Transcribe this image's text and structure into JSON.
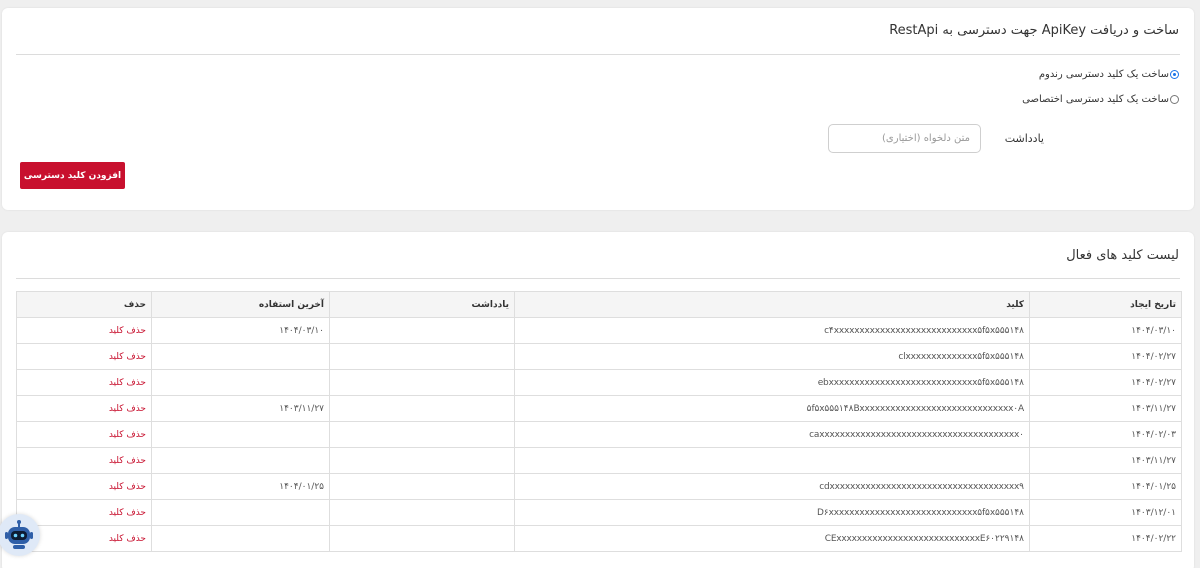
{
  "create_section": {
    "title": "ساخت و دریافت ApiKey جهت دسترسی به RestApi",
    "radio_random": {
      "label": "ساخت یک کلید دسترسی رندوم",
      "checked": true
    },
    "radio_custom": {
      "label": "ساخت یک کلید دسترسی اختصاصی",
      "checked": false
    },
    "note_label": "یادداشت",
    "note_placeholder": "متن دلخواه (اختیاری)",
    "note_value": "",
    "add_button": "افزودن کلید دسترسی",
    "accent_color": "#c8102e"
  },
  "active_keys": {
    "title": "لیست کلید های فعال",
    "columns": [
      "تاریخ ایجاد",
      "کلید",
      "یادداشت",
      "آخرین استفاده",
      "حذف"
    ],
    "rows": [
      {
        "created": "۱۴۰۴/۰۳/۱۰",
        "key": "c۴xxxxxxxxxxxxxxxxxxxxxxxxxxxx۵f۵x۵۵۵۱۴۸",
        "note": "",
        "last_used": "۱۴۰۴/۰۳/۱۰",
        "delete": "حذف کلید"
      },
      {
        "created": "۱۴۰۴/۰۲/۲۷",
        "key": "clxxxxxxxxxxxxxx۵f۵x۵۵۵۱۴۸",
        "note": "",
        "last_used": "",
        "delete": "حذف کلید"
      },
      {
        "created": "۱۴۰۴/۰۲/۲۷",
        "key": "ebxxxxxxxxxxxxxxxxxxxxxxxxxxxxx۵f۵x۵۵۵۱۴۸",
        "note": "",
        "last_used": "",
        "delete": "حذف کلید"
      },
      {
        "created": "۱۴۰۳/۱۱/۲۷",
        "key": "۵f۵x۵۵۵۱۴۸Bxxxxxxxxxxxxxxxxxxxxxxxxxxxxxx۰A",
        "note": "",
        "last_used": "۱۴۰۳/۱۱/۲۷",
        "delete": "حذف کلید"
      },
      {
        "created": "۱۴۰۴/۰۲/۰۳",
        "key": "caxxxxxxxxxxxxxxxxxxxxxxxxxxxxxxxxxxxxxxx۰",
        "note": "",
        "last_used": "",
        "delete": "حذف کلید"
      },
      {
        "created": "۱۴۰۳/۱۱/۲۷",
        "key": "",
        "note": "",
        "last_used": "",
        "delete": "حذف کلید"
      },
      {
        "created": "۱۴۰۴/۰۱/۲۵",
        "key": "cdxxxxxxxxxxxxxxxxxxxxxxxxxxxxxxxxxxxxx۹",
        "note": "",
        "last_used": "۱۴۰۴/۰۱/۲۵",
        "delete": "حذف کلید"
      },
      {
        "created": "۱۴۰۳/۱۲/۰۱",
        "key": "D۶xxxxxxxxxxxxxxxxxxxxxxxxxxxxx۵f۵x۵۵۵۱۴۸",
        "note": "",
        "last_used": "",
        "delete": "حذف کلید"
      },
      {
        "created": "۱۴۰۴/۰۲/۲۲",
        "key": "CExxxxxxxxxxxxxxxxxxxxxxxxxxxxE۶۰۲۲۹۱۴۸",
        "note": "",
        "last_used": "",
        "delete": "حذف کلید"
      }
    ]
  },
  "assistant_widget": {
    "icon": "robot-icon"
  }
}
